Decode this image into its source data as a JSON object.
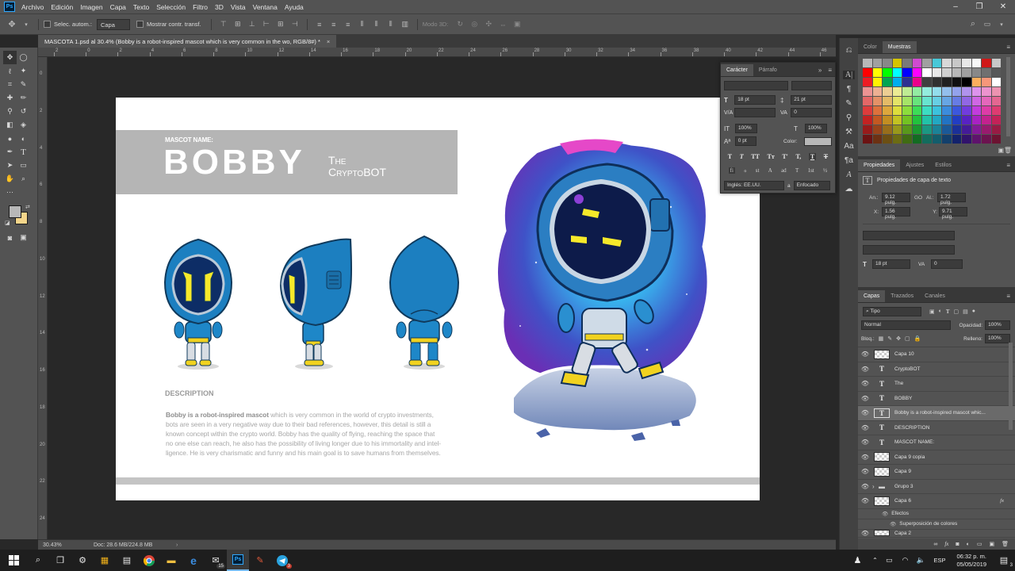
{
  "app": {
    "logo": "Ps",
    "menu": [
      "Archivo",
      "Edición",
      "Imagen",
      "Capa",
      "Texto",
      "Selección",
      "Filtro",
      "3D",
      "Vista",
      "Ventana",
      "Ayuda"
    ]
  },
  "options_bar": {
    "auto_select_label": "Selec. autom.:",
    "auto_select_value": "Capa",
    "show_transform_label": "Mostrar contr. transf.",
    "mode_3d_label": "Modo 3D:"
  },
  "document": {
    "tab_title": "MASCOTA 1.psd al 30.4% (Bobby is a robot-inspired mascot which is very common in the wo, RGB/8#) *",
    "tab_close": "×",
    "zoom": "30.43%",
    "doc_size": "Doc: 28.6 MB/224.8 MB"
  },
  "ruler": {
    "h_ticks": [
      "2",
      "0",
      "2",
      "4",
      "6",
      "8",
      "10",
      "12",
      "14",
      "16",
      "18",
      "20",
      "22",
      "24",
      "26",
      "28",
      "30",
      "32",
      "34",
      "36",
      "38",
      "40",
      "42",
      "44",
      "46"
    ],
    "v_ticks": [
      "0",
      "2",
      "4",
      "6",
      "8",
      "10",
      "12",
      "14",
      "16",
      "18",
      "20",
      "22",
      "24"
    ]
  },
  "artwork": {
    "mascot_name_label": "MASCOT NAME:",
    "name": "BOBBY",
    "subtitle_the": "The",
    "subtitle_crypto": "CryptoBOT",
    "description_heading": "DESCRIPTION",
    "description_lead": "Bobby is a robot-inspired mascot",
    "description_line1": " which is very common in the world of crypto investments,",
    "description_line2": "bots are seen in a very negative way due to their bad references, however, this detail is still a",
    "description_line3": "known concept within the crypto world. Bobby has the quality of flying, reaching the space that",
    "description_line4": "no one else can reach, he also has the possibility of living longer due to his immortality and intel-",
    "description_line5": "ligence. He is very charismatic and funny and his main goal is to save humans from themselves."
  },
  "character_panel": {
    "tabs": [
      "Carácter",
      "Párrafo"
    ],
    "font_size": "18 pt",
    "leading": "21 pt",
    "kerning": "",
    "tracking": "0",
    "vertical_scale": "100%",
    "horizontal_scale": "100%",
    "baseline_shift": "0 pt",
    "color_label": "Color:",
    "language": "Inglés: EE.UU.",
    "antialias": "Enfocado",
    "aa_label": "a",
    "style_buttons": [
      "T",
      "T",
      "TT",
      "Tт",
      "T'",
      "T,",
      "T",
      "T"
    ],
    "opentype_buttons": [
      "fi",
      "ℴ",
      "st",
      "A",
      "ad",
      "T",
      "1st",
      "½"
    ]
  },
  "swatches_panel": {
    "tabs": [
      "Color",
      "Muestras"
    ]
  },
  "properties_panel": {
    "tabs": [
      "Propiedades",
      "Ajustes",
      "Estilos"
    ],
    "title": "Propiedades de capa de texto",
    "width_label": "An.:",
    "width_value": "9.12 pulg.",
    "link_label": "GO",
    "height_label": "Al.:",
    "height_value": "1.72 pulg.",
    "x_label": "X:",
    "x_value": "1.56 pulg.",
    "y_label": "Y:",
    "y_value": "9.71 pulg.",
    "font_size": "18 pt",
    "tracking": "0"
  },
  "layers_panel": {
    "tabs": [
      "Capas",
      "Trazados",
      "Canales"
    ],
    "filter_label": "Tipo",
    "blend_mode": "Normal",
    "opacity_label": "Opacidad:",
    "opacity_value": "100%",
    "lock_label": "Bloq.:",
    "fill_label": "Relleno:",
    "fill_value": "100%",
    "layers": [
      {
        "name": "Capa 10",
        "kind": "pixel"
      },
      {
        "name": "CryptoBOT",
        "kind": "text"
      },
      {
        "name": "The",
        "kind": "text"
      },
      {
        "name": "BOBBY",
        "kind": "text"
      },
      {
        "name": "Bobby is a robot-inspired mascot whic...",
        "kind": "text",
        "selected": true
      },
      {
        "name": "DESCRIPTION",
        "kind": "text"
      },
      {
        "name": "MASCOT NAME:",
        "kind": "text"
      },
      {
        "name": "Capa 9 copia",
        "kind": "pixel"
      },
      {
        "name": "Capa 9",
        "kind": "pixel"
      },
      {
        "name": "Grupo 3",
        "kind": "group"
      },
      {
        "name": "Capa 6",
        "kind": "pixel",
        "fx": "fx"
      }
    ],
    "effects_label": "Efectos",
    "effect_name": "Superposición de colores",
    "last_layer": "Capa 2"
  },
  "taskbar": {
    "time": "06:32 p. m.",
    "date": "05/05/2019",
    "language": "ESP",
    "mail_badge": "15",
    "notif_badge": "3"
  }
}
